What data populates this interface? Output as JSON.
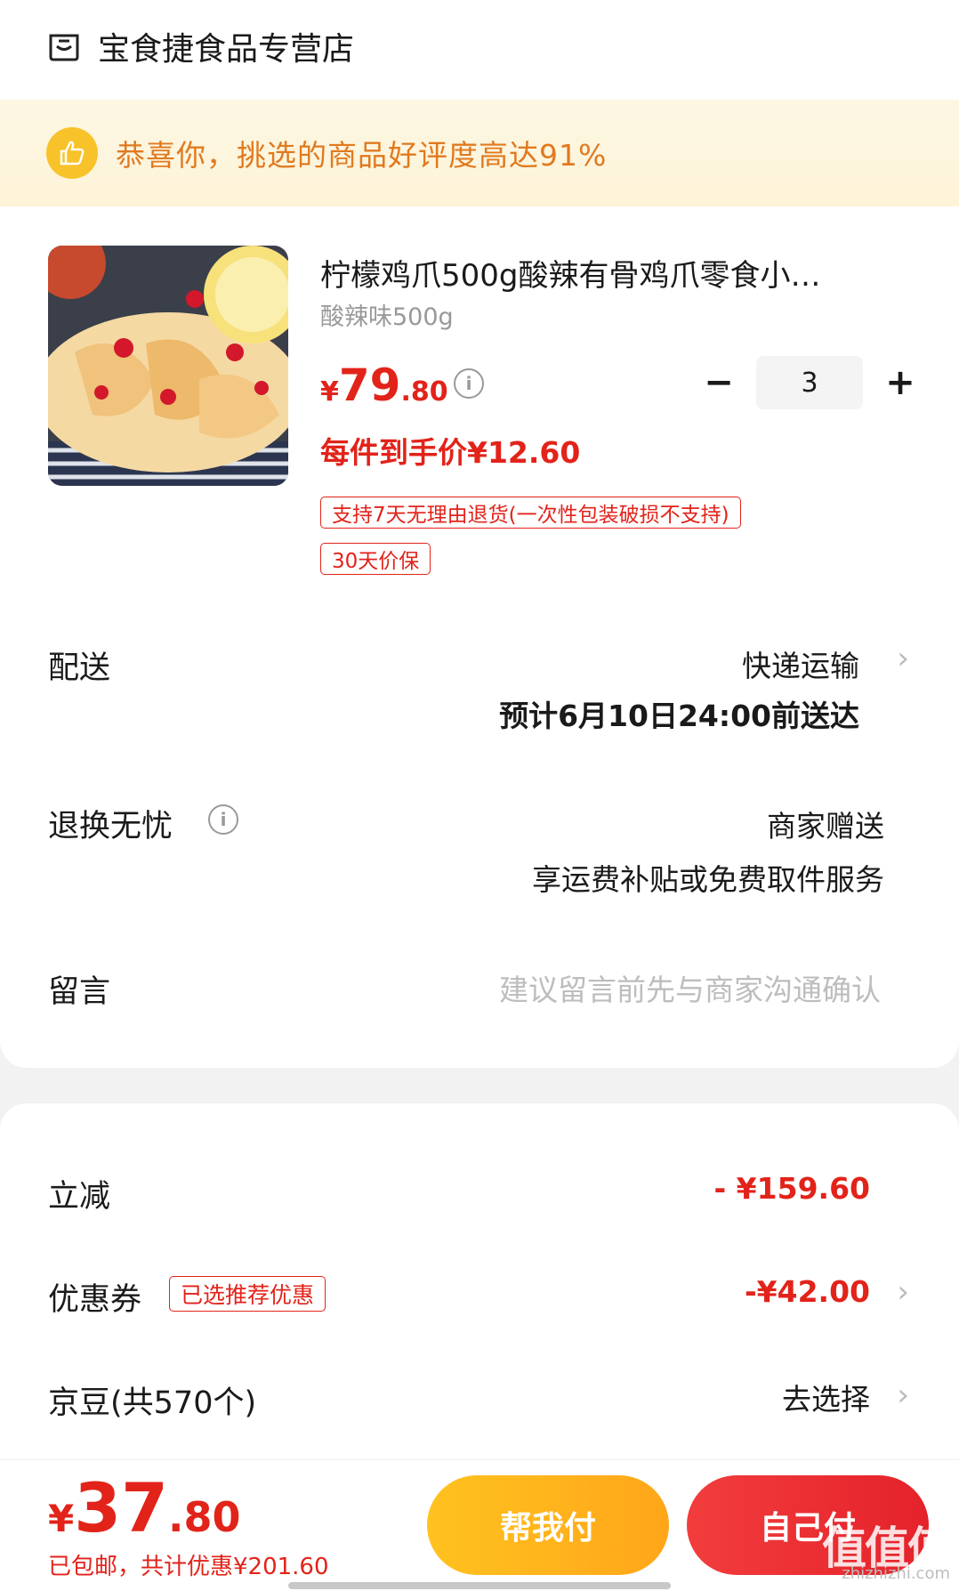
{
  "store": {
    "name": "宝食捷食品专营店"
  },
  "praise": {
    "text": "恭喜你，挑选的商品好评度高达91%"
  },
  "product": {
    "title": "柠檬鸡爪500g酸辣有骨鸡爪零食小…",
    "spec": "酸辣味500g",
    "price_symbol": "¥",
    "price_int": "79",
    "price_dec": ".80",
    "quantity": "3",
    "unit_price": "每件到手价¥12.60",
    "tags": [
      "支持7天无理由退货(一次性包装破损不支持)",
      "30天价保"
    ]
  },
  "delivery": {
    "label": "配送",
    "method": "快递运输",
    "eta": "预计6月10日24:00前送达"
  },
  "returns": {
    "label": "退换无忧",
    "line1": "商家赠送",
    "line2": "享运费补贴或免费取件服务"
  },
  "message": {
    "label": "留言",
    "placeholder": "建议留言前先与商家沟通确认"
  },
  "discounts": {
    "instant_label": "立减",
    "instant_value": "- ¥159.60",
    "coupon_label": "优惠券",
    "coupon_badge": "已选推荐优惠",
    "coupon_value": "-¥42.00",
    "beans_label": "京豆(共570个)",
    "beans_action": "去选择"
  },
  "footer": {
    "total_symbol": "¥",
    "total_int": "37",
    "total_dec": ".80",
    "summary": "已包邮，共计优惠¥201.60",
    "help_pay": "帮我付",
    "self_pay": "自己付"
  },
  "watermark": {
    "text": "值值值",
    "sub": "zhizhizhi.com"
  },
  "colors": {
    "accent_red": "#e2231a",
    "accent_yellow": "#ffb41f",
    "praise_text": "#e07a1f"
  },
  "icons": [
    "store-icon",
    "thumbs-up-icon",
    "info-icon",
    "minus-icon",
    "plus-icon",
    "chevron-right-icon"
  ]
}
